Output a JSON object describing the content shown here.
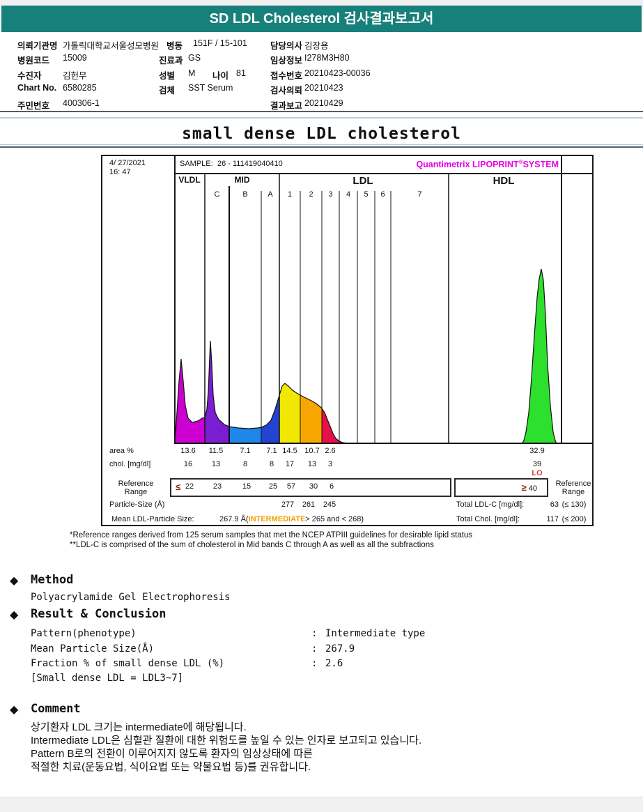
{
  "bullet": "◆",
  "header": {
    "title": "SD LDL Cholesterol 검사결과보고서"
  },
  "patient": {
    "org_label": "의뢰기관명",
    "org_value": "가톨릭대학교서울성모병원",
    "ward_label": "병동",
    "ward_value": "151F / 15-101",
    "doctor_label": "담당의사",
    "doctor_value": "김장용",
    "hospital_code_label": "병원코드",
    "hospital_code_value": "15009",
    "dept_label": "진료과",
    "dept_value": "GS",
    "clinical_label": "임상정보",
    "clinical_value": "I278M3H80",
    "name_label": "수진자",
    "name_value": "김헌무",
    "sex_label": "성별",
    "sex_value": "M",
    "age_label": "나이",
    "age_value": "81",
    "receipt_label": "접수번호",
    "receipt_value": "20210423-00036",
    "chart_label": "Chart No.",
    "chart_value": "6580285",
    "specimen_label": "검체",
    "specimen_value": "SST Serum",
    "order_label": "검사의뢰",
    "order_value": "20210423",
    "resident_label": "주민번호",
    "resident_value": "400306-1",
    "report_label": "결과보고",
    "report_value": "20210429"
  },
  "section_title": "small dense LDL cholesterol",
  "chart": {
    "date_line1": "4/ 27/2021",
    "date_line2": "16: 47",
    "sample_label": "SAMPLE:",
    "sample_value": "26 - 111419040410",
    "brand1": "Quantimetrix LIPOPRINT",
    "brand_reg": "®",
    "brand2": "SYSTEM",
    "zones": [
      "VLDL",
      "MID",
      "LDL",
      "HDL"
    ],
    "band_labels": [
      "C",
      "B",
      "A",
      "1",
      "2",
      "3",
      "4",
      "5",
      "6",
      "7"
    ],
    "area_label": "area %",
    "area_values": [
      "13.6",
      "11.5",
      "7.1",
      "7.1",
      "14.5",
      "10.7",
      "2.6"
    ],
    "area_hdl": "32.9",
    "chol_label": "chol. [mg/dl]",
    "chol_values": [
      "16",
      "13",
      "8",
      "8",
      "17",
      "13",
      "3"
    ],
    "chol_hdl": "39",
    "chol_hdl_flag": "LO",
    "ref_label": "Reference Range",
    "ref_le": "≤",
    "ref_values": [
      "22",
      "23",
      "15",
      "25",
      "57",
      "30",
      "6"
    ],
    "ref_ge": "≥",
    "ref_hdl": "40",
    "psize_label": "Particle-Size (Å)",
    "psize_values": [
      "277",
      "261",
      "245"
    ],
    "mean_label": "Mean LDL-Particle Size:",
    "mean_value": "267.9 Å",
    "mean_open": "(",
    "mean_class": "INTERMEDIATE",
    "mean_close": "> 265 and < 268)",
    "total_ldl_label": "Total LDL-C [mg/dl]:",
    "total_ldl_value": "63",
    "total_ldl_ref": "(≤ 130)",
    "total_chol_label": "Total Chol. [mg/dl]:",
    "total_chol_value": "117",
    "total_chol_ref": "(≤ 200)"
  },
  "footnotes": [
    "*Reference ranges derived from 125 serum samples that met the NCEP ATPIII guidelines for desirable lipid status",
    "**LDL-C is comprised of the sum of cholesterol in Mid bands C through A as well as all the subfractions"
  ],
  "method": {
    "heading": "Method",
    "body": "Polyacrylamide Gel Electrophoresis"
  },
  "result": {
    "heading": "Result & Conclusion",
    "rows": [
      {
        "label": "Pattern(phenotype)",
        "sep": ":",
        "value": "Intermediate type"
      },
      {
        "label": "Mean Particle Size(Å)",
        "sep": ":",
        "value": "267.9"
      },
      {
        "label": "Fraction % of small dense LDL (%)",
        "sep": ":",
        "value": "2.6"
      }
    ],
    "note": "[Small dense LDL = LDL3~7]"
  },
  "comment": {
    "heading": "Comment",
    "lines": [
      "상기환자 LDL 크기는 intermediate에 해당됩니다.",
      "Intermediate LDL은 심혈관 질환에 대한 위험도를 높일 수 있는 인자로 보고되고 있습니다.",
      "Pattern B로의 전환이 이루어지지 않도록 환자의 임상상태에 따른",
      "적절한 치료(운동요법, 식이요법 또는 약물요법 등)를 권유합니다."
    ]
  },
  "chart_data": {
    "type": "area",
    "title": "small dense LDL cholesterol",
    "instrument": "Quantimetrix LIPOPRINT SYSTEM",
    "sample": "26 - 111419040410",
    "datetime": "4/27/2021 16:47",
    "bands": [
      "VLDL",
      "MID C",
      "MID B",
      "MID A",
      "LDL 1",
      "LDL 2",
      "LDL 3",
      "HDL"
    ],
    "area_percent": [
      13.6,
      11.5,
      7.1,
      7.1,
      14.5,
      10.7,
      2.6,
      32.9
    ],
    "chol_mg_dl": [
      16,
      13,
      8,
      8,
      17,
      13,
      3,
      39
    ],
    "reference_range": [
      "≤ 22",
      "23",
      "15",
      "25",
      "57",
      "30",
      "6",
      "≥ 40"
    ],
    "flags": {
      "HDL_chol": "LO"
    },
    "particle_size_A": {
      "LDL 1": 277,
      "LDL 2": 261,
      "LDL 3": 245
    },
    "mean_ldl_particle_size_A": 267.9,
    "pattern": "INTERMEDIATE (> 265 and < 268)",
    "total_ldl_c_mg_dl": 63,
    "total_ldl_c_ref": "≤ 130",
    "total_chol_mg_dl": 117,
    "total_chol_ref": "≤ 200",
    "band_colors": {
      "VLDL": "#cc00d0",
      "MID C": "#7a1ed2",
      "MID B": "#1e87e8",
      "MID A": "#2244d0",
      "LDL 1": "#f0e800",
      "LDL 2": "#f7a600",
      "LDL 3": "#e81048",
      "HDL": "#2ee02e"
    }
  },
  "colors": {
    "header_teal": "#17807b",
    "brand_magenta": "#e600e6",
    "flag_red": "#cc4433",
    "ref_maroon": "#8b2500",
    "intermediate_orange": "#f0a000"
  }
}
